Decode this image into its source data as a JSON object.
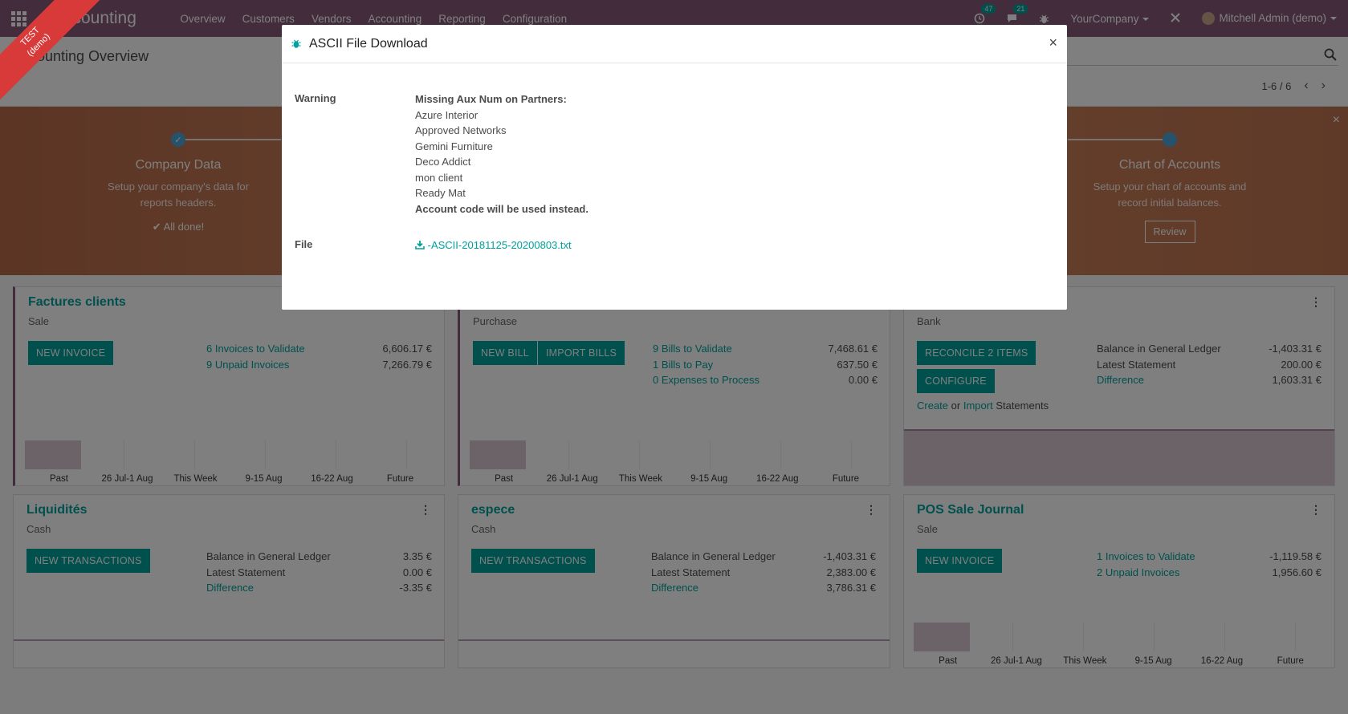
{
  "navbar": {
    "brand": "Accounting",
    "menu": [
      "Overview",
      "Customers",
      "Vendors",
      "Accounting",
      "Reporting",
      "Configuration"
    ],
    "activity_count": "47",
    "message_count": "21",
    "company": "YourCompany",
    "user": "Mitchell Admin (demo)"
  },
  "control_panel": {
    "breadcrumb": "Accounting Overview",
    "pager": "1-6 / 6"
  },
  "ribbon": {
    "line1": "TEST",
    "line2": "(demo)"
  },
  "banner": {
    "step1": {
      "title": "Company Data",
      "desc1": "Setup your company's data for",
      "desc2": "reports headers.",
      "done": "✔ All done!"
    },
    "step4": {
      "title": "Chart of Accounts",
      "desc1": "Setup your chart of accounts and",
      "desc2": "record initial balances.",
      "button": "Review"
    }
  },
  "cards": {
    "factures": {
      "title": "Factures clients",
      "subtitle": "Sale",
      "button": "New Invoice",
      "rows": [
        {
          "label": "6 Invoices to Validate",
          "value": "6,606.17 €"
        },
        {
          "label": "9 Unpaid Invoices",
          "value": "7,266.79 €"
        }
      ]
    },
    "purchase": {
      "subtitle": "Purchase",
      "button1": "New Bill",
      "button2": "Import Bills",
      "rows": [
        {
          "label": "9 Bills to Validate",
          "value": "7,468.61 €"
        },
        {
          "label": "1 Bills to Pay",
          "value": "637.50 €"
        },
        {
          "label": "0 Expenses to Process",
          "value": "0.00 €"
        }
      ]
    },
    "bank": {
      "subtitle": "Bank",
      "button1": "Reconcile 2 Items",
      "button2": "Configure",
      "create": "Create",
      "or": "or",
      "import": "Import",
      "statements": "Statements",
      "rows": [
        {
          "label": "Balance in General Ledger",
          "value": "-1,403.31 €"
        },
        {
          "label": "Latest Statement",
          "value": "200.00 €"
        },
        {
          "label": "Difference",
          "value": "1,603.31 €"
        }
      ]
    },
    "liquidites": {
      "title": "Liquidités",
      "subtitle": "Cash",
      "button": "New Transactions",
      "rows": [
        {
          "label": "Balance in General Ledger",
          "value": "3.35 €"
        },
        {
          "label": "Latest Statement",
          "value": "0.00 €"
        },
        {
          "label": "Difference",
          "value": "-3.35 €"
        }
      ]
    },
    "espece": {
      "title": "espece",
      "subtitle": "Cash",
      "button": "New Transactions",
      "rows": [
        {
          "label": "Balance in General Ledger",
          "value": "-1,403.31 €"
        },
        {
          "label": "Latest Statement",
          "value": "2,383.00 €"
        },
        {
          "label": "Difference",
          "value": "3,786.31 €"
        }
      ]
    },
    "pos": {
      "title": "POS Sale Journal",
      "subtitle": "Sale",
      "button": "New Invoice",
      "rows": [
        {
          "label": "1 Invoices to Validate",
          "value": "-1,119.58 €"
        },
        {
          "label": "2 Unpaid Invoices",
          "value": "1,956.60 €"
        }
      ]
    },
    "chart_labels": [
      "Past",
      "26 Jul-1 Aug",
      "This Week",
      "9-15 Aug",
      "16-22 Aug",
      "Future"
    ]
  },
  "modal": {
    "title": "ASCII File Download",
    "warning_label": "Warning",
    "warning_heading": "Missing Aux Num on Partners:",
    "partners": [
      "Azure Interior",
      "Approved Networks",
      "Gemini Furniture",
      "Deco Addict",
      "mon client",
      "Ready Mat"
    ],
    "warning_footer": "Account code will be used instead.",
    "file_label": "File",
    "file_name": "-ASCII-20181125-20200803.txt"
  }
}
